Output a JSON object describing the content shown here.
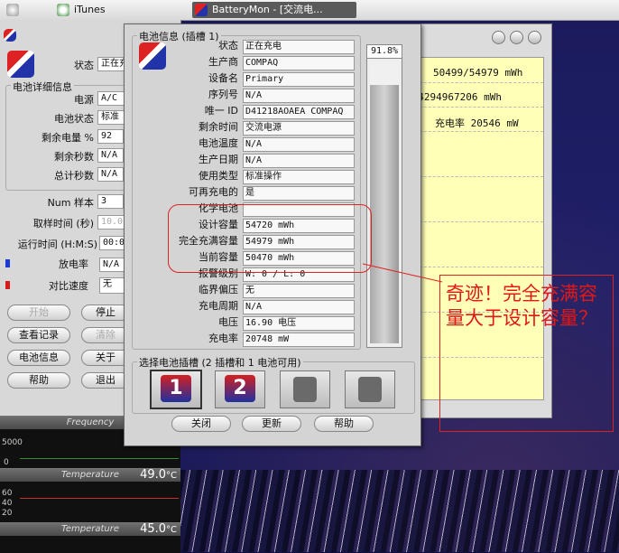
{
  "taskbar": {
    "items": [
      {
        "label": "",
        "icon": "apple-icon"
      },
      {
        "label": "iTunes",
        "icon": "itunes-icon"
      },
      {
        "label": "BatteryMon - [交流电...",
        "icon": "batterymon-icon"
      }
    ]
  },
  "bg_window": {
    "status_label": "状态",
    "status_value": "正在充",
    "group_title": "电池详细信息",
    "fields": [
      {
        "label": "电源",
        "value": "A/C"
      },
      {
        "label": "电池状态",
        "value": "标准"
      },
      {
        "label": "剩余电量 %",
        "value": "92"
      },
      {
        "label": "剩余秒数",
        "value": "N/A"
      },
      {
        "label": "总计秒数",
        "value": "N/A"
      }
    ],
    "num_samples_label": "Num 样本",
    "num_samples_value": "3",
    "sample_time_label": "取样时间 (秒)",
    "sample_time_value": "10.0",
    "runtime_label": "运行时间 (H:M:S)",
    "runtime_value": "00:00",
    "discharge_label": "放电率",
    "discharge_value": "N/A",
    "compare_label": "对比速度",
    "compare_value": "无",
    "buttons": [
      {
        "label": "开始",
        "enabled": false
      },
      {
        "label": "停止",
        "enabled": true
      },
      {
        "label": "查看记录",
        "enabled": true
      },
      {
        "label": "清除",
        "enabled": false
      },
      {
        "label": "电池信息",
        "enabled": true
      },
      {
        "label": "关于",
        "enabled": true
      },
      {
        "label": "帮助",
        "enabled": true
      },
      {
        "label": "退出",
        "enabled": true
      }
    ]
  },
  "monitors": [
    {
      "title": "Frequency",
      "value": "",
      "scale_top": "5000",
      "scale_bottom": "0"
    },
    {
      "title": "Temperature",
      "value": "49.0",
      "unit": "°C",
      "scales": [
        "60",
        "40",
        "20"
      ]
    },
    {
      "title": "Temperature",
      "value": "45.0",
      "unit": "°C"
    }
  ],
  "log_window": {
    "rows": [
      "50499/54979 mWh",
      "≠ 4294967206 mWh",
      "充电率 20546 mW"
    ]
  },
  "dialog": {
    "group_title": "电池信息 (插槽 1)",
    "fields": [
      {
        "label": "状态",
        "value": "正在充电"
      },
      {
        "label": "生产商",
        "value": "COMPAQ"
      },
      {
        "label": "设备名",
        "value": "Primary"
      },
      {
        "label": "序列号",
        "value": "N/A"
      },
      {
        "label": "唯一 ID",
        "value": "D41218AOAEA COMPAQ"
      },
      {
        "label": "剩余时间",
        "value": "交流电源"
      },
      {
        "label": "电池温度",
        "value": "N/A"
      },
      {
        "label": "生产日期",
        "value": "N/A"
      },
      {
        "label": "使用类型",
        "value": "标准操作"
      },
      {
        "label": "可再充电的",
        "value": "是"
      },
      {
        "label": "化学电池",
        "value": ""
      },
      {
        "label": "设计容量",
        "value": "54720 mWh"
      },
      {
        "label": "完全充满容量",
        "value": "54979 mWh"
      },
      {
        "label": "当前容量",
        "value": "50470 mWh"
      },
      {
        "label": "报警级别",
        "value": "W: 0 / L: 0"
      },
      {
        "label": "临界偏压",
        "value": "无"
      },
      {
        "label": "充电周期",
        "value": "N/A"
      },
      {
        "label": "电压",
        "value": "16.90 电压"
      },
      {
        "label": "充电率",
        "value": "20748 mW"
      }
    ],
    "gauge_percent_text": "91.8%",
    "gauge_fraction": 0.918,
    "slot_group_title": "选择电池插槽 (2 插槽和 1 电池可用)",
    "slots": [
      {
        "label": "1",
        "present": true,
        "selected": true
      },
      {
        "label": "2",
        "present": true,
        "selected": false
      },
      {
        "label": "",
        "present": false,
        "selected": false
      },
      {
        "label": "",
        "present": false,
        "selected": false
      }
    ],
    "buttons": [
      "关闭",
      "更新",
      "帮助"
    ]
  },
  "annotation": {
    "text": "奇迹！完全充满容量大于设计容量？",
    "color": "#e01818"
  }
}
